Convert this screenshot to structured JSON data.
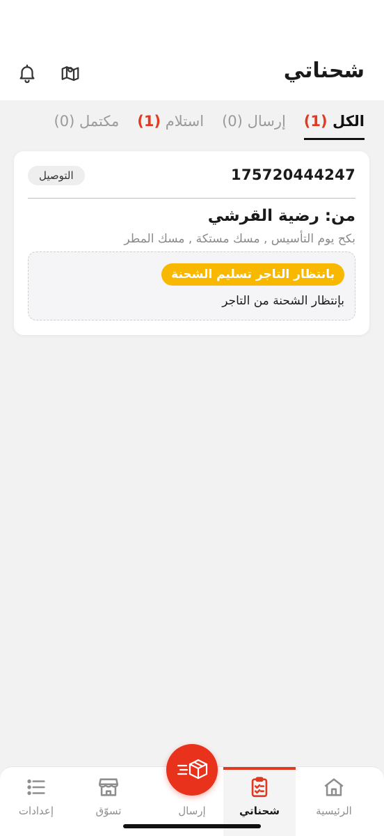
{
  "header": {
    "title": "شحناتي",
    "icons": [
      "bell-icon",
      "map-icon"
    ]
  },
  "tabs": [
    {
      "label": "الكل",
      "count": "(1)",
      "active": true
    },
    {
      "label": "إرسال",
      "count": "(0)",
      "active": false
    },
    {
      "label": "استلام",
      "count": "(1)",
      "active": false
    },
    {
      "label": "مكتمل",
      "count": "(0)",
      "active": false
    }
  ],
  "shipment": {
    "tracking_number": "175720444247",
    "type": "التوصيل",
    "from": "من: رضية القرشي",
    "address": "بكح يوم التأسيس , مسك مستكة , مسك المطر",
    "status": "بانتظار التاجر تسليم الشحنة",
    "status_description": "بإنتظار الشحنة من التاجر"
  },
  "bottom_nav": {
    "items": [
      {
        "label": "الرئيسية",
        "icon": "home-icon",
        "active": false
      },
      {
        "label": "شحناتي",
        "icon": "clipboard-icon",
        "active": true
      },
      {
        "label": "إرسال",
        "icon": "package-icon",
        "active": false
      },
      {
        "label": "تسوّق",
        "icon": "store-icon",
        "active": false
      },
      {
        "label": "إعدادات",
        "icon": "list-icon",
        "active": false
      }
    ]
  },
  "colors": {
    "accent": "#e03a22",
    "status_chip": "#f9b800",
    "background": "#f2f2f2"
  }
}
